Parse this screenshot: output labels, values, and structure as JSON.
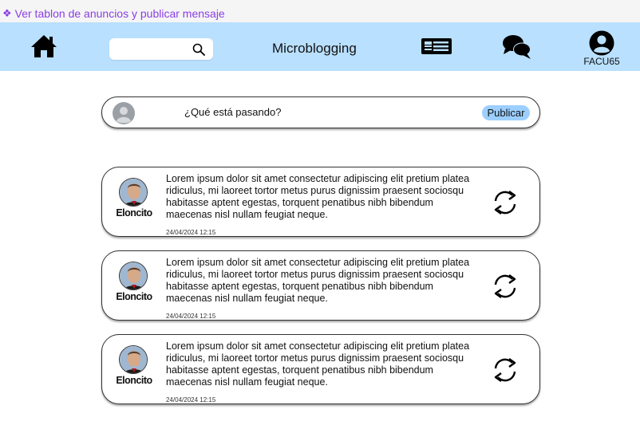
{
  "topbar": {
    "link_text": "Ver tablon de anuncios y publicar mensaje",
    "link_color": "#8a3ee6"
  },
  "navbar": {
    "background": "#b9e0ff",
    "home_icon": "home-icon",
    "search": {
      "value": "",
      "placeholder": "",
      "icon": "search-icon"
    },
    "title": "Microblogging",
    "news_icon": "newspaper-icon",
    "chat_icon": "chat-bubbles-icon",
    "profile": {
      "icon": "user-circle-icon",
      "username": "FACU65"
    }
  },
  "compose": {
    "prompt": "¿Qué está pasando?",
    "publish_label": "Publicar",
    "publish_color": "#9ccfff"
  },
  "posts": [
    {
      "author": "Eloncito",
      "text": "Lorem ipsum dolor sit amet consectetur adipiscing elit pretium platea ridiculus, mi laoreet tortor metus purus dignissim praesent sociosqu habitasse aptent egestas, torquent penatibus nibh bibendum maecenas nisl nullam feugiat neque.",
      "date": "24/04/2024 12:15",
      "action_icon": "repost-icon"
    },
    {
      "author": "Eloncito",
      "text": "Lorem ipsum dolor sit amet consectetur adipiscing elit pretium platea ridiculus, mi laoreet tortor metus purus dignissim praesent sociosqu habitasse aptent egestas, torquent penatibus nibh bibendum maecenas nisl nullam feugiat neque.",
      "date": "24/04/2024 12:15",
      "action_icon": "repost-icon"
    },
    {
      "author": "Eloncito",
      "text": "Lorem ipsum dolor sit amet consectetur adipiscing elit pretium platea ridiculus, mi laoreet tortor metus purus dignissim praesent sociosqu habitasse aptent egestas, torquent penatibus nibh bibendum maecenas nisl nullam feugiat neque.",
      "date": "24/04/2024 12:15",
      "action_icon": "repost-icon"
    }
  ]
}
